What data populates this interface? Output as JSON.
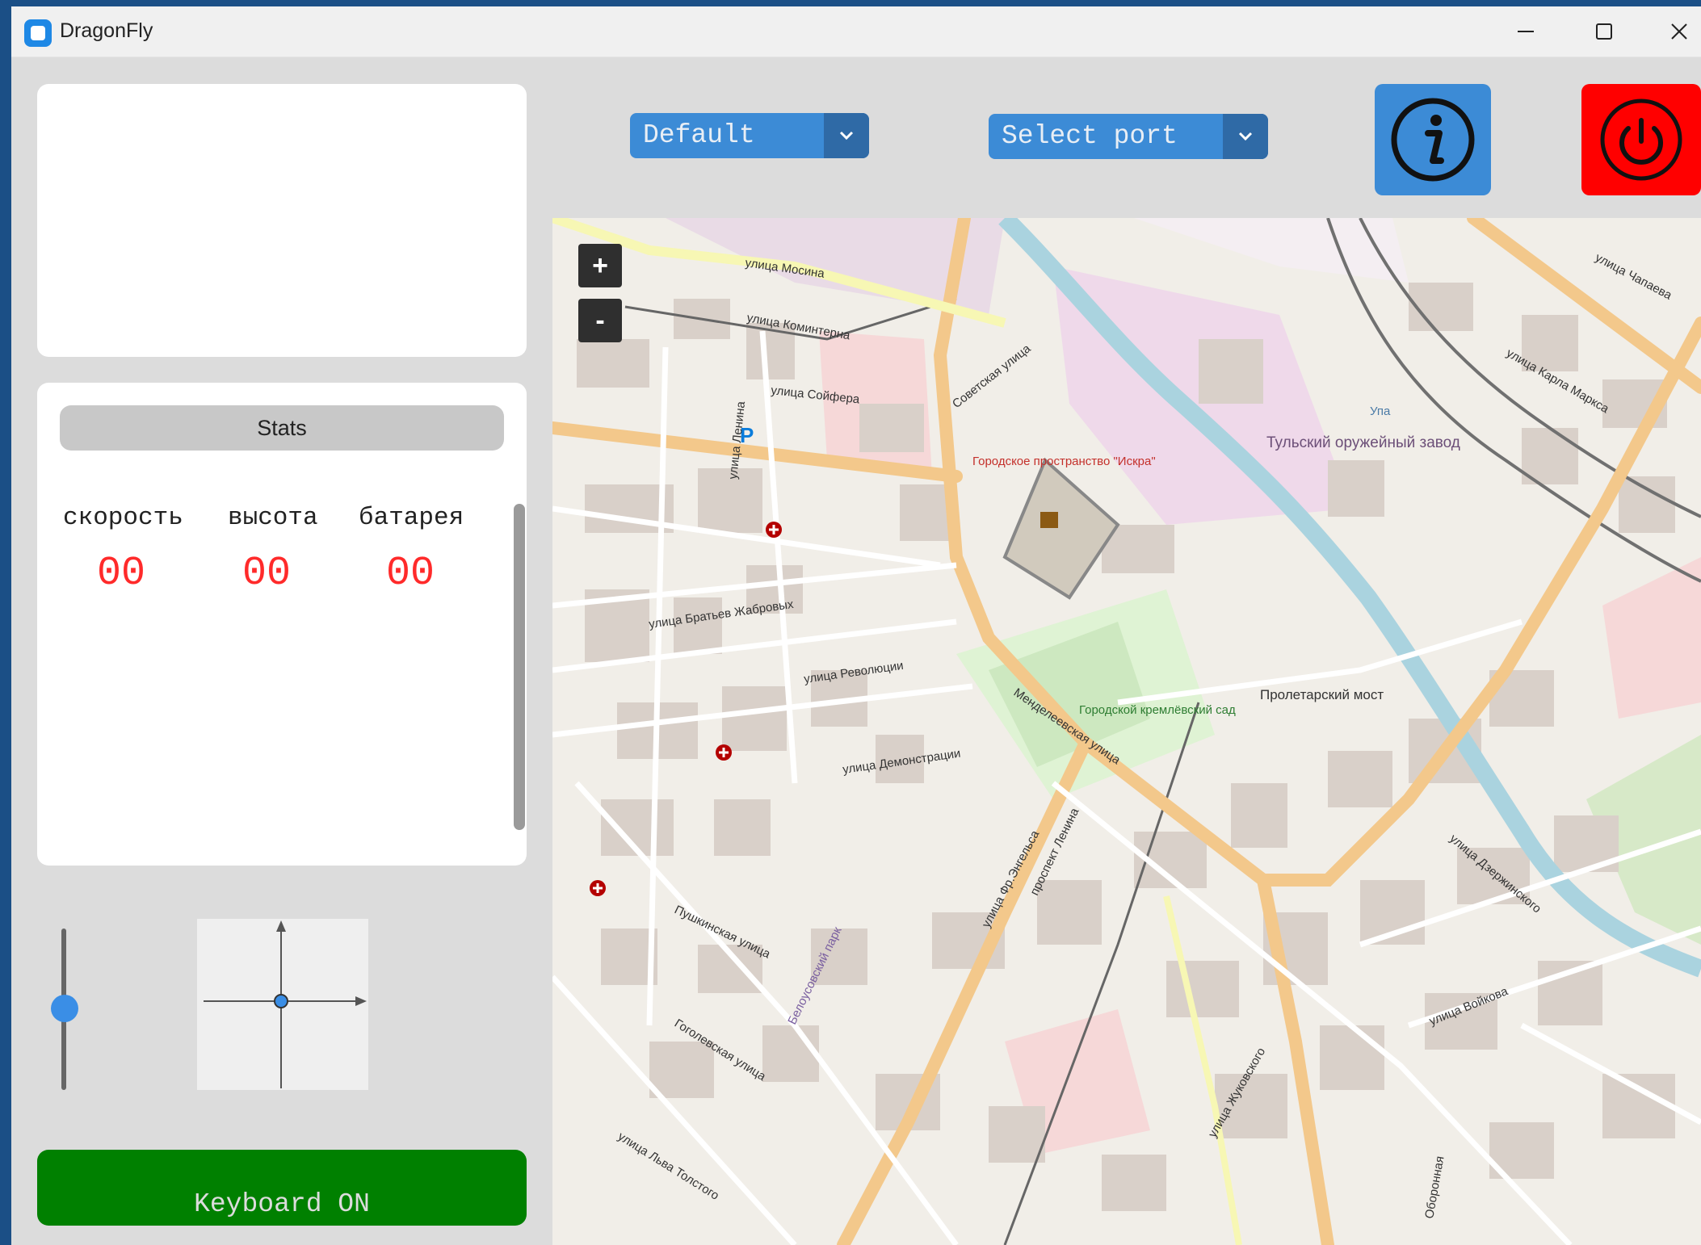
{
  "window": {
    "title": "DragonFly"
  },
  "stats": {
    "header": "Stats",
    "speed_label": "скорость",
    "altitude_label": "высота",
    "battery_label": "батарея",
    "speed_value": "00",
    "altitude_value": "00",
    "battery_value": "00"
  },
  "controls": {
    "mode_select": "Default",
    "port_select": "Select port",
    "keyboard_button": "Keyboard ON"
  },
  "map": {
    "zoom_in": "+",
    "zoom_out": "-",
    "labels": [
      "улица Мосина",
      "улица Коминтерна",
      "улица Сойфера",
      "Советская улица",
      "Городское пространство \"Искра\"",
      "Тульский оружейный завод",
      "Упа",
      "улица Братьев Жабровых",
      "улица Революции",
      "улица Демонстрации",
      "Менделеевская улица",
      "Городской кремлёвский сад",
      "Пролетарский мост",
      "улица Дзержинского",
      "проспект Ленина",
      "Пушкинская улица",
      "Белоусовский парк",
      "улица Фр.Энгельса",
      "улица Карла Маркса",
      "улица Чапаева",
      "улица Войкова",
      "улица Жуковского",
      "Гоголевская улица",
      "улица Льва Толстого",
      "Оборонная",
      "улица Ленина"
    ]
  },
  "colors": {
    "accent": "#3c8bd6",
    "power": "#ff0000",
    "keyboard_on": "#008000",
    "stat_value": "#ff2a2a"
  }
}
